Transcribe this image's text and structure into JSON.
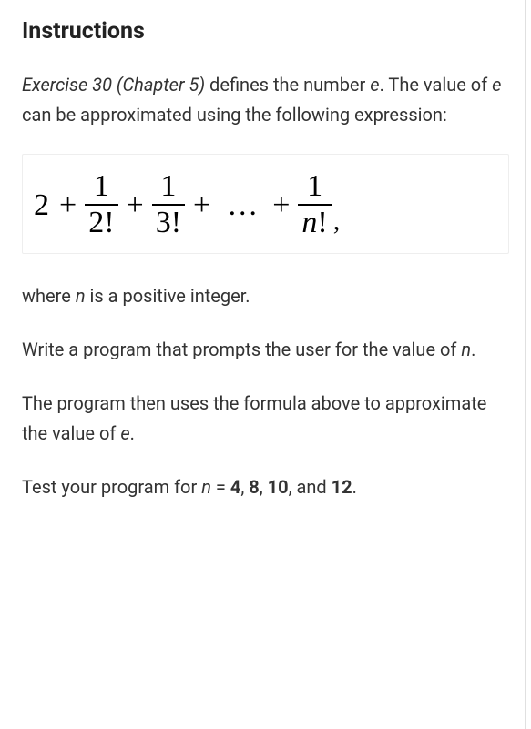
{
  "title": "Instructions",
  "intro": {
    "exercise_ref": "Exercise 30 (Chapter 5)",
    "line1_rest": " defines the number ",
    "e1": "e",
    "line2_a": ". The value of ",
    "e2": "e",
    "line2_b": " can be approximated using the following expression:"
  },
  "formula": {
    "leading": "2",
    "plus": "+",
    "dots": "…",
    "comma": ",",
    "fractions": [
      {
        "num": "1",
        "den": "2!"
      },
      {
        "num": "1",
        "den": "3!"
      },
      {
        "num": "1",
        "den_var": "n",
        "den_suffix": "!"
      }
    ]
  },
  "where": {
    "a": "where ",
    "n": "n",
    "b": " is a positive integer."
  },
  "write": {
    "a": "Write a program that prompts the user for the value of ",
    "n": "n",
    "b": "."
  },
  "uses": {
    "a": "The program then uses the formula above to approximate the value of ",
    "e": "e",
    "b": "."
  },
  "test": {
    "a": "Test your program for ",
    "n": "n",
    "b": " = ",
    "v1": "4",
    "c1": ", ",
    "v2": "8",
    "c2": ", ",
    "v3": "10",
    "c3": ", and ",
    "v4": "12",
    "end": "."
  }
}
